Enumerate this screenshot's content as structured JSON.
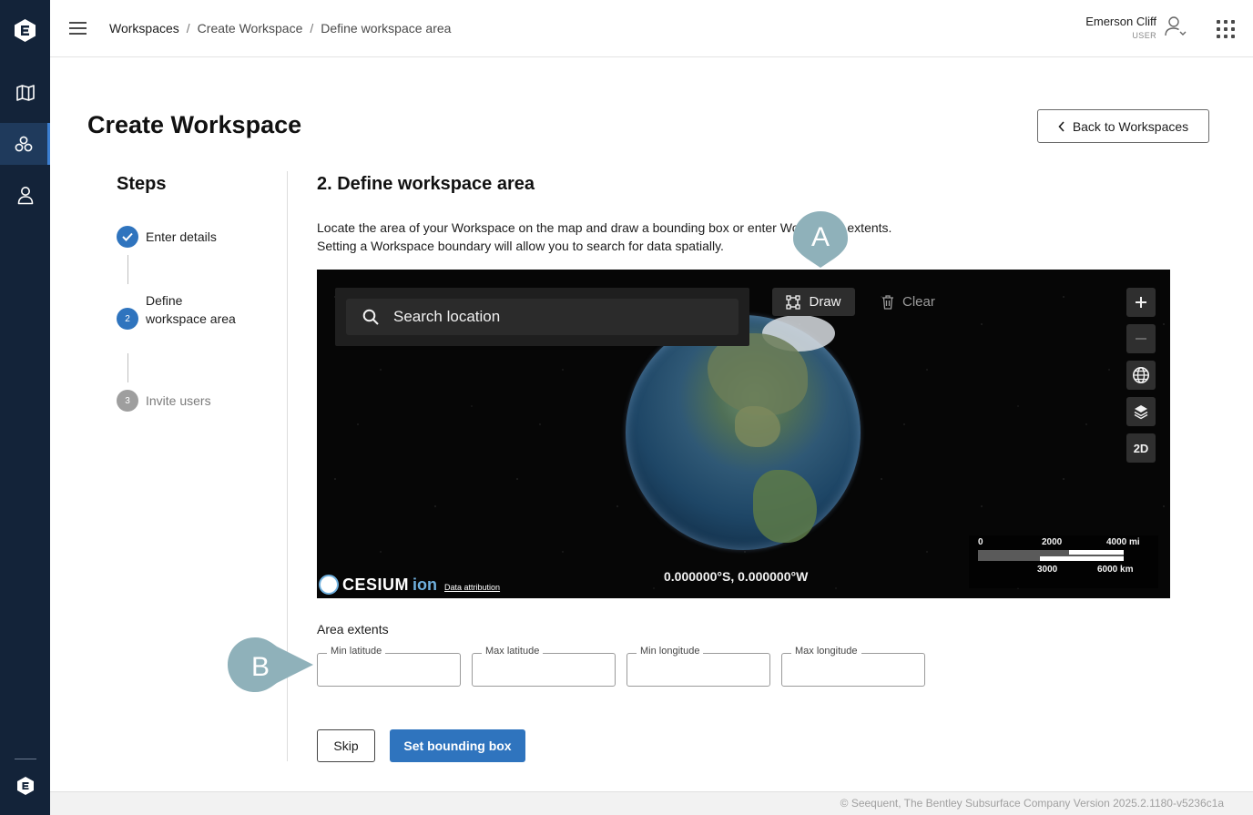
{
  "header": {
    "breadcrumb": [
      "Workspaces",
      "Create Workspace",
      "Define workspace area"
    ],
    "breadcrumb_separator": "/",
    "user_name": "Emerson Cliff",
    "user_role": "USER"
  },
  "sidebar": {
    "items": [
      {
        "icon": "map-icon",
        "active": false
      },
      {
        "icon": "workspaces-icon",
        "active": true
      },
      {
        "icon": "user-icon",
        "active": false
      }
    ]
  },
  "page": {
    "title": "Create Workspace",
    "back_button": "Back to Workspaces"
  },
  "steps": {
    "title": "Steps",
    "items": [
      {
        "number": "1",
        "label": "Enter details",
        "state": "complete"
      },
      {
        "number": "2",
        "label": "Define workspace area",
        "state": "active"
      },
      {
        "number": "3",
        "label": "Invite users",
        "state": "pending"
      }
    ]
  },
  "section": {
    "title": "2. Define workspace area",
    "description_line1": "Locate the area of your Workspace on the map and draw a bounding box or enter Workspace extents.",
    "description_line2": "Setting a Workspace boundary will allow you to search for data spatially."
  },
  "map": {
    "search_placeholder": "Search location",
    "draw_label": "Draw",
    "clear_label": "Clear",
    "view_mode": "2D",
    "coordinates": "0.000000°S, 0.000000°W",
    "scale": {
      "top": [
        "0",
        "2000",
        "4000 mi"
      ],
      "bottom": [
        "3000",
        "6000 km"
      ]
    },
    "cesium_brand": "CESIUM",
    "cesium_ion": "ion",
    "data_attribution": "Data attribution"
  },
  "callouts": {
    "a": "A",
    "b": "B"
  },
  "area_extents": {
    "label": "Area extents",
    "fields": [
      {
        "label": "Min latitude",
        "value": ""
      },
      {
        "label": "Max latitude",
        "value": ""
      },
      {
        "label": "Min longitude",
        "value": ""
      },
      {
        "label": "Max longitude",
        "value": ""
      }
    ]
  },
  "actions": {
    "skip": "Skip",
    "set_bounding_box": "Set bounding box"
  },
  "footer": {
    "text": "© Seequent, The Bentley Subsurface Company   Version 2025.2.1180-v5236c1a"
  },
  "colors": {
    "rail_bg": "#132339",
    "primary": "#2f74be",
    "callout": "#8fb1ba"
  }
}
